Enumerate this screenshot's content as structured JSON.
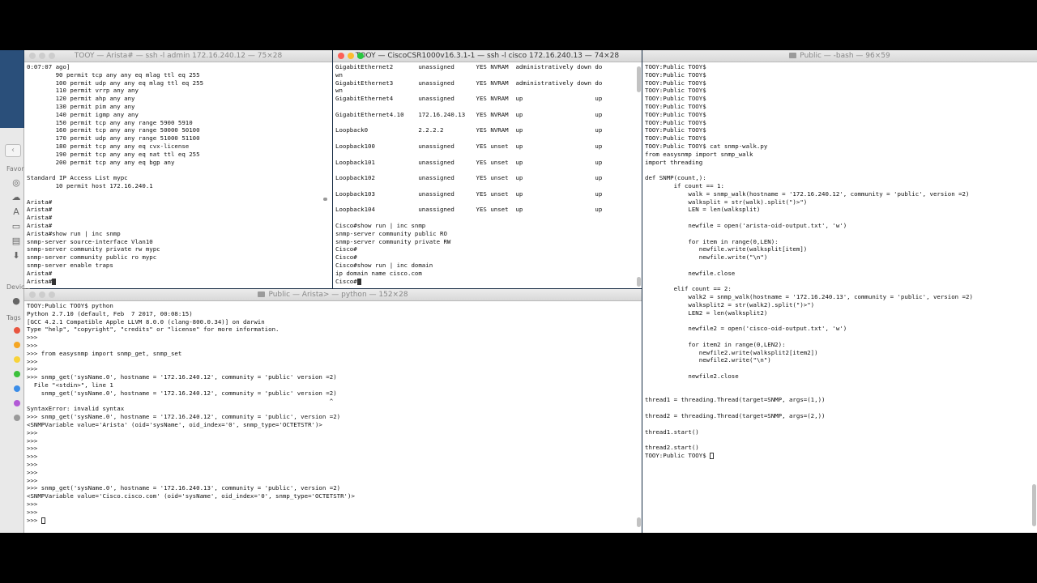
{
  "arista": {
    "title": "TOOY — Arista# — ssh -l admin 172.16.240.12 — 75×28",
    "lines": [
      "0:07:07 ago]",
      "        90 permit tcp any any eq mlag ttl eq 255",
      "        100 permit udp any any eq mlag ttl eq 255",
      "        110 permit vrrp any any",
      "        120 permit ahp any any",
      "        130 permit pim any any",
      "        140 permit igmp any any",
      "        150 permit tcp any any range 5900 5910",
      "        160 permit tcp any any range 50000 50100",
      "        170 permit udp any any range 51000 51100",
      "        180 permit tcp any any eq cvx-license",
      "        190 permit tcp any any eq nat ttl eq 255",
      "        200 permit tcp any any eq bgp any",
      "",
      "Standard IP Access List mypc",
      "        10 permit host 172.16.240.1",
      "",
      "Arista#",
      "Arista#",
      "Arista#",
      "Arista#",
      "Arista#show run | inc snmp",
      "snmp-server source-interface Vlan10",
      "snmp-server community private rw mypc",
      "snmp-server community public ro mypc",
      "snmp-server enable traps",
      "Arista#",
      "Arista#"
    ]
  },
  "cisco": {
    "title": "TOOY — CiscoCSR1000v16.3.1-1 — ssh -l cisco 172.16.240.13 — 74×28",
    "lines": [
      "GigabitEthernet2       unassigned      YES NVRAM  administratively down do",
      "wn",
      "GigabitEthernet3       unassigned      YES NVRAM  administratively down do",
      "wn",
      "GigabitEthernet4       unassigned      YES NVRAM  up                    up",
      "",
      "GigabitEthernet4.10    172.16.240.13   YES NVRAM  up                    up",
      "",
      "Loopback0              2.2.2.2         YES NVRAM  up                    up",
      "",
      "Loopback100            unassigned      YES unset  up                    up",
      "",
      "Loopback101            unassigned      YES unset  up                    up",
      "",
      "Loopback102            unassigned      YES unset  up                    up",
      "",
      "Loopback103            unassigned      YES unset  up                    up",
      "",
      "Loopback104            unassigned      YES unset  up                    up",
      "",
      "Cisco#show run | inc snmp",
      "snmp-server community public RO",
      "snmp-server community private RW",
      "Cisco#",
      "Cisco#",
      "Cisco#show run | inc domain",
      "ip domain name cisco.com",
      "Cisco#"
    ]
  },
  "python": {
    "title": "Public — Arista> — python — 152×28",
    "lines": [
      "TOOY:Public TOOY$ python",
      "Python 2.7.10 (default, Feb  7 2017, 00:08:15)",
      "[GCC 4.2.1 Compatible Apple LLVM 8.0.0 (clang-800.0.34)] on darwin",
      "Type \"help\", \"copyright\", \"credits\" or \"license\" for more information.",
      ">>>",
      ">>>",
      ">>> from easysnmp import snmp_get, snmp_set",
      ">>>",
      ">>>",
      ">>> snmp_get('sysName.0', hostname = '172.16.240.12', community = 'public' version =2)",
      "  File \"<stdin>\", line 1",
      "    snmp_get('sysName.0', hostname = '172.16.240.12', community = 'public' version =2)",
      "                                                                                    ^",
      "SyntaxError: invalid syntax",
      ">>> snmp_get('sysName.0', hostname = '172.16.240.12', community = 'public', version =2)",
      "<SNMPVariable value='Arista' (oid='sysName', oid_index='0', snmp_type='OCTETSTR')>",
      ">>>",
      ">>>",
      ">>>",
      ">>>",
      ">>>",
      ">>>",
      ">>>",
      ">>> snmp_get('sysName.0', hostname = '172.16.240.13', community = 'public', version =2)",
      "<SNMPVariable value='Cisco.cisco.com' (oid='sysName', oid_index='0', snmp_type='OCTETSTR')>",
      ">>>",
      ">>>",
      ">>> "
    ]
  },
  "bash": {
    "title": "Public — -bash — 96×59",
    "lines": [
      "TOOY:Public TOOY$",
      "TOOY:Public TOOY$",
      "TOOY:Public TOOY$",
      "TOOY:Public TOOY$",
      "TOOY:Public TOOY$",
      "TOOY:Public TOOY$",
      "TOOY:Public TOOY$",
      "TOOY:Public TOOY$",
      "TOOY:Public TOOY$",
      "TOOY:Public TOOY$",
      "TOOY:Public TOOY$ cat snmp-walk.py",
      "from easysnmp import snmp_walk",
      "import threading",
      "",
      "def SNMP(count,):",
      "        if count == 1:",
      "            walk = snmp_walk(hostname = '172.16.240.12', community = 'public', version =2)",
      "            walksplit = str(walk).split(\")>\")",
      "            LEN = len(walksplit)",
      "",
      "            newfile = open('arista-oid-output.txt', 'w')",
      "",
      "            for item in range(0,LEN):",
      "               newfile.write(walksplit[item])",
      "               newfile.write(\"\\n\")",
      "",
      "            newfile.close",
      "",
      "        elif count == 2:",
      "            walk2 = snmp_walk(hostname = '172.16.240.13', community = 'public', version =2)",
      "            walksplit2 = str(walk2).split(\")>\")",
      "            LEN2 = len(walksplit2)",
      "",
      "            newfile2 = open('cisco-oid-output.txt', 'w')",
      "",
      "            for item2 in range(0,LEN2):",
      "               newfile2.write(walksplit2[item2])",
      "               newfile2.write(\"\\n\")",
      "",
      "            newfile2.close",
      "",
      "",
      "thread1 = threading.Thread(target=SNMP, args=(1,))",
      "",
      "thread2 = threading.Thread(target=SNMP, args=(2,))",
      "",
      "thread1.start()",
      "",
      "thread2.start()",
      "TOOY:Public TOOY$ "
    ]
  },
  "finder": {
    "sections": [
      "Favori",
      "Device",
      "Tags"
    ],
    "tag_colors": [
      "#e8553f",
      "#f5a623",
      "#f8d33a",
      "#3cc13b",
      "#3b8de8",
      "#b25ad6",
      "#9a9a9a"
    ]
  }
}
